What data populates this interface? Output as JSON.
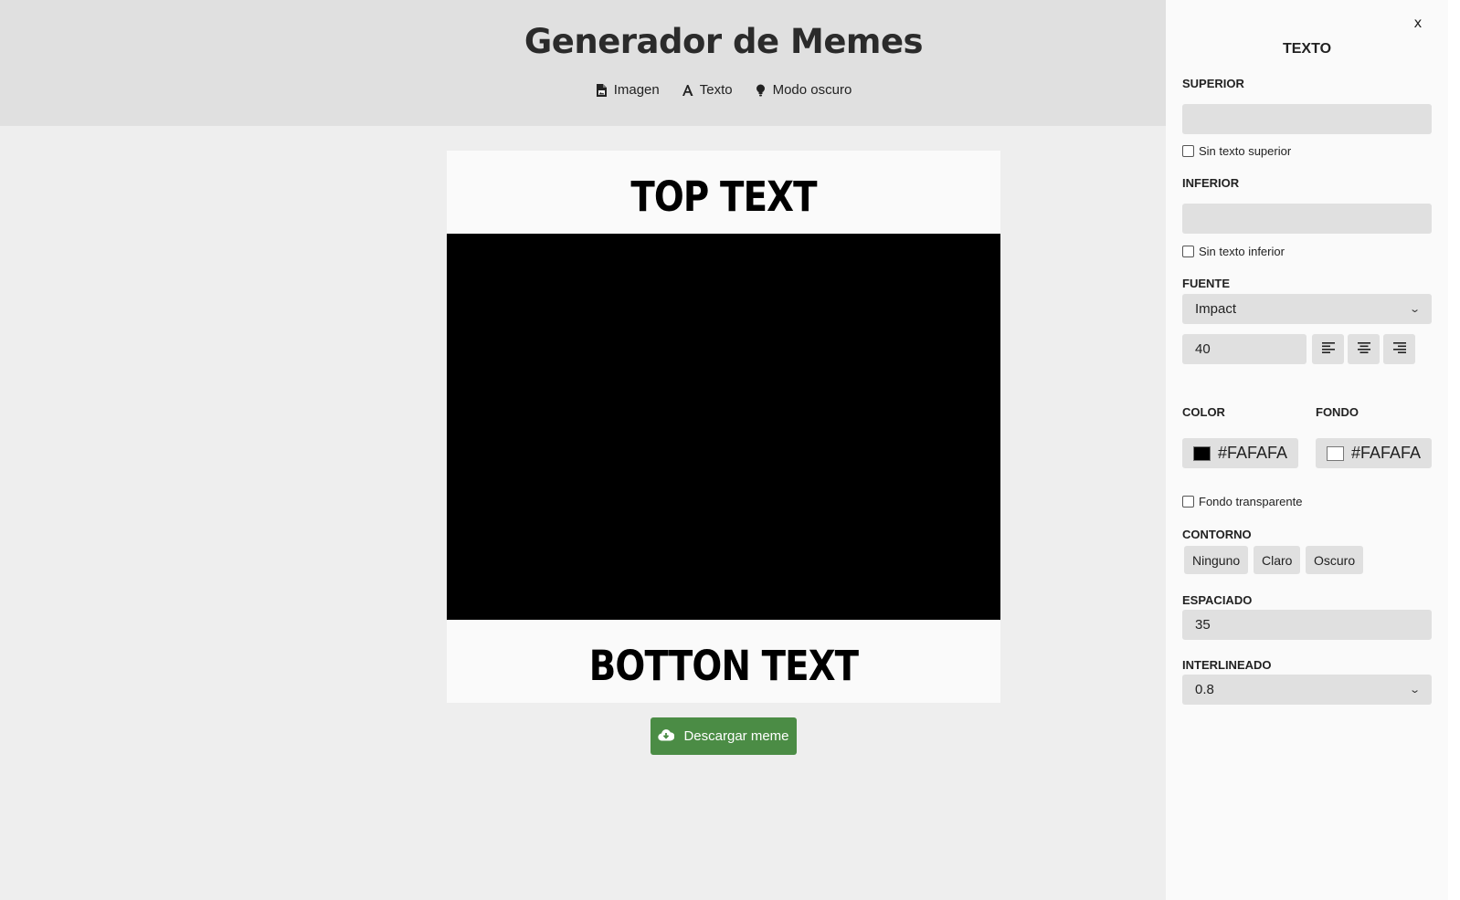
{
  "header": {
    "title": "Generador de Memes",
    "nav": [
      {
        "label": "Imagen",
        "icon": "image-file-icon"
      },
      {
        "label": "Texto",
        "icon": "font-icon"
      },
      {
        "label": "Modo oscuro",
        "icon": "lightbulb-icon"
      }
    ]
  },
  "meme": {
    "top_text": "TOP TEXT",
    "bottom_text": "BOTTON TEXT",
    "image_color": "#000000",
    "background_color": "#FAFAFA"
  },
  "download": {
    "label": "Descargar meme",
    "color": "#4B8C45"
  },
  "panel": {
    "close_label": "x",
    "title": "TEXTO",
    "top": {
      "label": "SUPERIOR",
      "value": "",
      "checkbox_label": "Sin texto superior",
      "checked": false
    },
    "bottom": {
      "label": "INFERIOR",
      "value": "",
      "checkbox_label": "Sin texto inferior",
      "checked": false
    },
    "font": {
      "label": "FUENTE",
      "selected": "Impact",
      "size": "40"
    },
    "align": [
      "align-left-icon",
      "align-center-icon",
      "align-right-icon"
    ],
    "color": {
      "label": "COLOR",
      "value": "#FAFAFA",
      "swatch": "#000000"
    },
    "background": {
      "label": "FONDO",
      "value": "#FAFAFA",
      "swatch": "#FFFFFF"
    },
    "transparent": {
      "label": "Fondo transparente",
      "checked": false
    },
    "outline": {
      "label": "CONTORNO",
      "options": [
        "Ninguno",
        "Claro",
        "Oscuro"
      ]
    },
    "spacing": {
      "label": "ESPACIADO",
      "value": "35"
    },
    "line_height": {
      "label": "INTERLINEADO",
      "selected": "0.8"
    }
  }
}
